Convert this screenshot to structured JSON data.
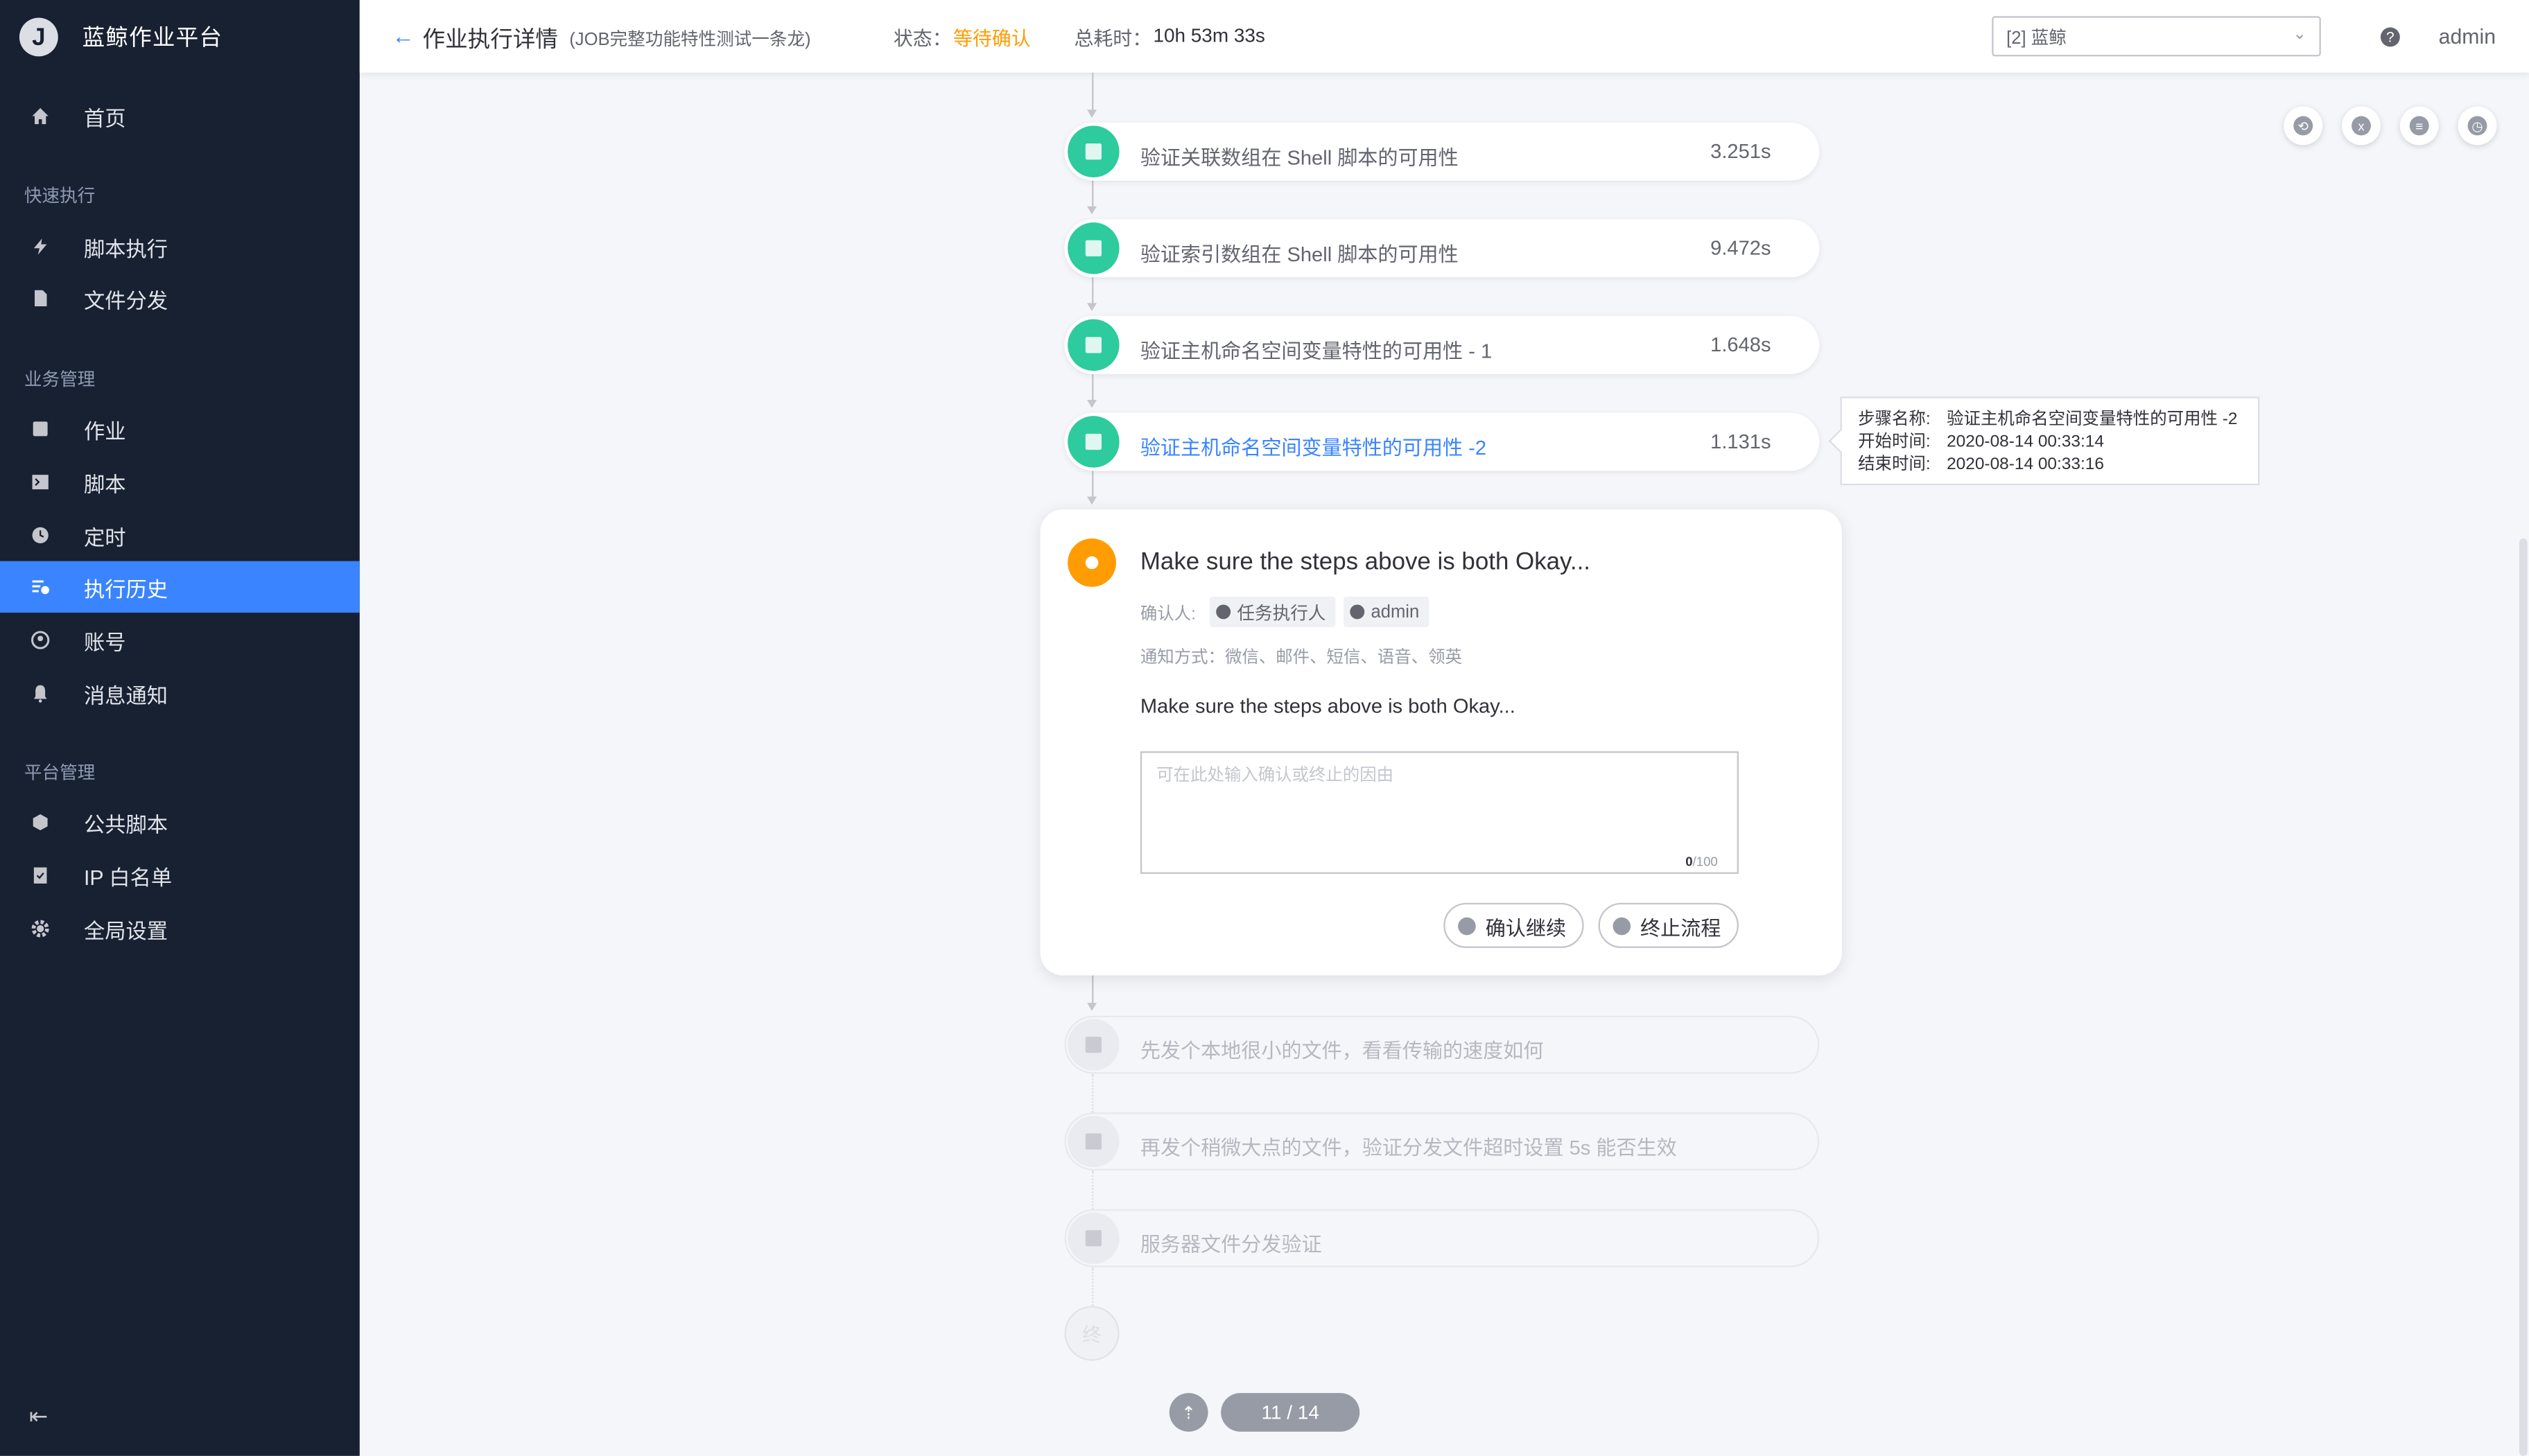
{
  "app": {
    "logo_letter": "J",
    "name": "蓝鲸作业平台"
  },
  "sidebar": {
    "home": "首页",
    "groups": [
      {
        "title": "快速执行"
      },
      {
        "title": "业务管理"
      },
      {
        "title": "平台管理"
      }
    ],
    "items": [
      {
        "label": "脚本执行"
      },
      {
        "label": "文件分发"
      },
      {
        "label": "作业"
      },
      {
        "label": "脚本"
      },
      {
        "label": "定时"
      },
      {
        "label": "执行历史",
        "active": true
      },
      {
        "label": "账号"
      },
      {
        "label": "消息通知"
      },
      {
        "label": "公共脚本"
      },
      {
        "label": "IP 白名单"
      },
      {
        "label": "全局设置"
      }
    ]
  },
  "header": {
    "title": "作业执行详情",
    "subtitle": "(JOB完整功能特性测试一条龙)",
    "status_label": "状态：",
    "status_value": "等待确认",
    "time_label": "总耗时：",
    "time_value": "10h 53m 33s",
    "business": "[2] 蓝鲸",
    "help": "?",
    "user": "admin"
  },
  "steps": [
    {
      "name": "验证关联数组在 Shell 脚本的可用性",
      "duration": "3.251s"
    },
    {
      "name": "验证索引数组在 Shell 脚本的可用性",
      "duration": "9.472s"
    },
    {
      "name": "验证主机命名空间变量特性的可用性 - 1",
      "duration": "1.648s"
    },
    {
      "name": "验证主机命名空间变量特性的可用性 -2",
      "duration": "1.131s"
    }
  ],
  "tooltip": {
    "name_label": "步骤名称:",
    "name_value": "验证主机命名空间变量特性的可用性 -2",
    "start_label": "开始时间:",
    "start_value": "2020-08-14 00:33:14",
    "end_label": "结束时间:",
    "end_value": "2020-08-14 00:33:16"
  },
  "confirm": {
    "title": "Make sure the steps above is both Okay...",
    "confirmer_label": "确认人:",
    "confirmers": [
      "任务执行人",
      "admin"
    ],
    "notify": "通知方式：微信、邮件、短信、语音、领英",
    "description": "Make sure the steps above is both Okay...",
    "placeholder": "可在此处输入确认或终止的因由",
    "count_current": "0",
    "count_max": "/100",
    "confirm_button": "确认继续",
    "abort_button": "终止流程"
  },
  "pending_steps": [
    {
      "name": "先发个本地很小的文件，看看传输的速度如何"
    },
    {
      "name": "再发个稍微大点的文件，验证分发文件超时设置 5s 能否生效"
    },
    {
      "name": "服务器文件分发验证"
    }
  ],
  "end_label": "终",
  "pager": {
    "text": "11 / 14"
  },
  "colors": {
    "sidebar_bg": "#182132",
    "accent": "#3a84ff",
    "success": "#2dcb9d",
    "warning": "#ff9c01"
  }
}
